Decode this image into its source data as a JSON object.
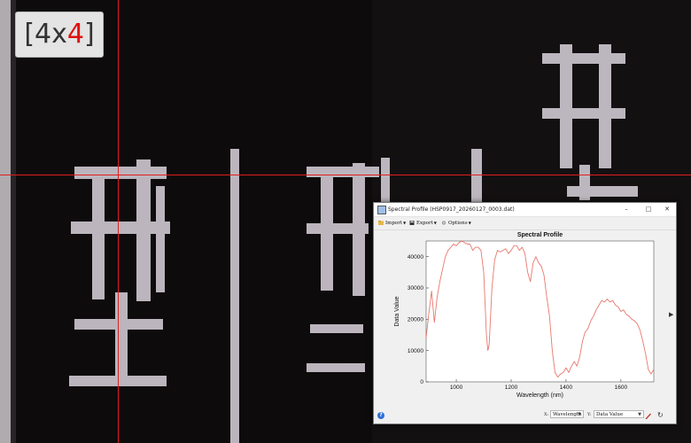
{
  "viewer": {
    "zoom_prefix": "[4x",
    "zoom_value": "4",
    "zoom_suffix": "]"
  },
  "window": {
    "title": "Spectral Profile (HSP0917_20260127_0003.dat)",
    "controls": {
      "minimize": "–",
      "maximize": "□",
      "close": "✕"
    },
    "toolbar": {
      "import_label": "Import",
      "export_label": "Export",
      "options_label": "Options"
    },
    "bottom": {
      "help": "?",
      "x_tag": "X:",
      "x_value": "Wavelength",
      "y_tag": "Y:",
      "y_value": "Data Value",
      "refresh": "↻"
    }
  },
  "chart_data": {
    "type": "line",
    "title": "Spectral Profile",
    "xlabel": "Wavelength (nm)",
    "ylabel": "Data Value",
    "xlim": [
      890,
      1720
    ],
    "ylim": [
      0,
      45000
    ],
    "xticks": [
      "1000",
      "1200",
      "1400",
      "1600"
    ],
    "yticks": [
      "0",
      "10000",
      "20000",
      "30000",
      "40000"
    ],
    "grid": false,
    "line_color": "#e8786e",
    "series": [
      {
        "x": [
          890,
          900,
          910,
          920,
          930,
          940,
          950,
          960,
          970,
          980,
          990,
          1000,
          1010,
          1020,
          1030,
          1040,
          1050,
          1060,
          1070,
          1080,
          1090,
          1100,
          1110,
          1115,
          1120,
          1130,
          1140,
          1150,
          1160,
          1170,
          1180,
          1190,
          1200,
          1210,
          1220,
          1230,
          1240,
          1250,
          1260,
          1270,
          1280,
          1290,
          1300,
          1310,
          1320,
          1330,
          1340,
          1350,
          1360,
          1370,
          1380,
          1390,
          1400,
          1410,
          1420,
          1430,
          1440,
          1450,
          1460,
          1470,
          1480,
          1490,
          1500,
          1510,
          1520,
          1530,
          1540,
          1550,
          1560,
          1570,
          1580,
          1590,
          1600,
          1610,
          1620,
          1630,
          1640,
          1650,
          1660,
          1670,
          1680,
          1690,
          1700,
          1710,
          1720
        ],
        "y": [
          14000,
          22000,
          29000,
          19000,
          27000,
          32000,
          36000,
          40000,
          42000,
          43000,
          44000,
          43500,
          44500,
          45000,
          44500,
          44000,
          44000,
          42000,
          43000,
          43000,
          42000,
          35000,
          15000,
          10000,
          12000,
          30000,
          39000,
          42000,
          41500,
          42000,
          42500,
          41000,
          42000,
          43500,
          43500,
          42000,
          43000,
          41000,
          35000,
          32000,
          38000,
          40000,
          38000,
          37000,
          34000,
          27000,
          21000,
          10000,
          3000,
          1500,
          2500,
          3000,
          4500,
          3000,
          5000,
          6500,
          5000,
          8000,
          13000,
          16000,
          17000,
          19500,
          21000,
          23000,
          24500,
          26000,
          25500,
          26500,
          25500,
          26000,
          24500,
          24000,
          22500,
          23000,
          21500,
          21000,
          20000,
          19500,
          18500,
          16500,
          13000,
          9000,
          4000,
          2500,
          4000
        ]
      }
    ]
  }
}
